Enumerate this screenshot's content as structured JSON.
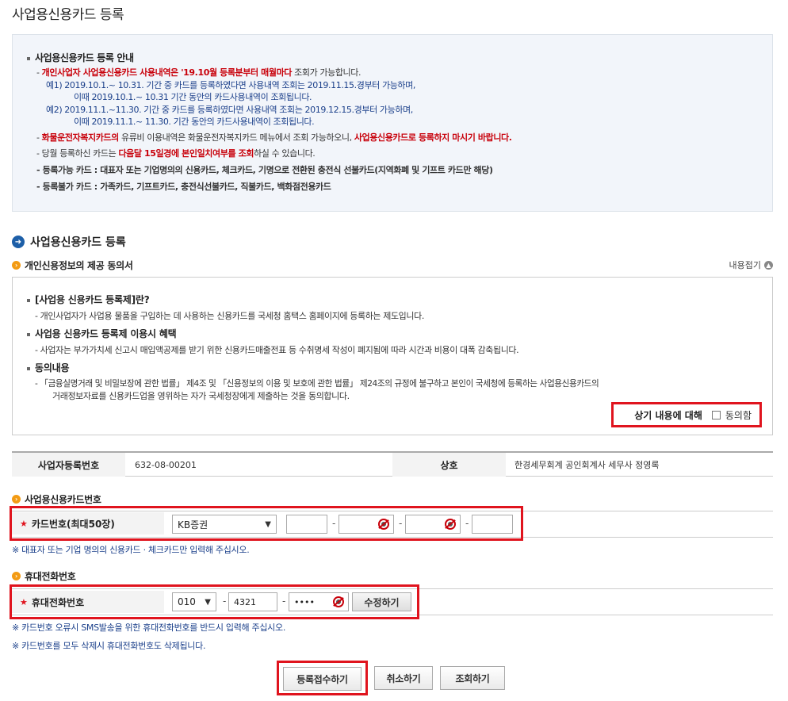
{
  "page_title": "사업용신용카드 등록",
  "guide": {
    "heading": "사업용신용카드 등록 안내",
    "l1_dash": "- ",
    "l1_red": "개인사업자 사업용신용카드 사용내역은 '19.10월 등록분부터 매월마다",
    "l1_rest": " 조회가 가능합니다.",
    "ex1_a": "예1) 2019.10.1.~ 10.31. 기간 중 카드를 등록하였다면 사용내역 조회는 2019.11.15.경부터 가능하며,",
    "ex1_b": "이때 2019.10.1.~ 10.31 기간 동안의 카드사용내역이 조회됩니다.",
    "ex2_a": "예2) 2019.11.1.~11.30. 기간 중 카드를 등록하였다면 사용내역 조회는 2019.12.15.경부터 가능하며,",
    "ex2_b": "이때 2019.11.1.~ 11.30. 기간 동안의 카드사용내역이 조회됩니다.",
    "l2_red1": "화물운전자복지카드의",
    "l2_mid": " 유류비 이용내역은 화물운전자복지카드 메뉴에서 조회 가능하오니, ",
    "l2_red2": "사업용신용카드로 등록하지 마시기 바랍니다.",
    "l3_a": "당월 등록하신 카드는 ",
    "l3_red": "다음달 15일경에 본인일치여부를 조회",
    "l3_b": "하실 수 있습니다.",
    "l4": "등록가능 카드 : 대표자 또는 기업명의의 신용카드, 체크카드, 기명으로 전환된 충전식 선불카드(지역화폐 및 기프트 카드만 해당)",
    "l5": "등록불가 카드 : 가족카드, 기프트카드, 충전식선불카드, 직불카드, 백화점전용카드"
  },
  "section_title": "사업용신용카드 등록",
  "consent": {
    "title": "개인신용정보의 제공 동의서",
    "collapse_label": "내용접기",
    "h1": "[사업용 신용카드 등록제]란?",
    "t1": "- 개인사업자가 사업용 물품을 구입하는 데 사용하는 신용카드를 국세청 홈택스 홈페이지에 등록하는 제도입니다.",
    "h2": "사업용 신용카드 등록제 이용시 혜택",
    "t2": "- 사업자는 부가가치세 신고시 매입액공제를 받기 위한 신용카드매출전표 등 수취명세 작성이 폐지됨에 따라 시간과 비용이 대폭 감축됩니다.",
    "h3": "동의내용",
    "t3a": "- 「금융실명거래 및 비밀보장에 관한 법률」 제4조 및 「신용정보의 이용 및 보호에 관한 법률」 제24조의 규정에 불구하고 본인이 국세청에 등록하는 사업용신용카드의",
    "t3b": "거래정보자료를 신용카드업을 영위하는 자가 국세청장에게 제출하는 것을 동의합니다.",
    "agree_label": "상기 내용에 대해",
    "agree_checkbox": "동의함"
  },
  "biz_info": {
    "reg_no_label": "사업자등록번호",
    "reg_no_value": "632-08-00201",
    "name_label": "상호",
    "name_value": "한경세무회계 공인회계사 세무사 정영록"
  },
  "card": {
    "title": "사업용신용카드번호",
    "label": "카드번호(최대50장)",
    "company": "KB증권",
    "dash": "-",
    "note": "※ 대표자 또는 기업 명의의 신용카드 · 체크카드만 입력해 주십시오."
  },
  "phone": {
    "title": "휴대전화번호",
    "label": "휴대전화번호",
    "prefix": "010",
    "middle": "4321",
    "last_masked": "••••",
    "dash": "-",
    "edit_button": "수정하기",
    "note1": "※ 카드번호 오류시 SMS발송을 위한 휴대전화번호를 반드시 입력해 주십시오.",
    "note2": "※ 카드번호를 모두 삭제시 휴대전화번호도 삭제됩니다."
  },
  "buttons": {
    "submit": "등록접수하기",
    "cancel": "취소하기",
    "inquiry": "조회하기"
  },
  "colors": {
    "highlight_red": "#c8000a",
    "frame_red": "#e0141e",
    "note_blue": "#1a3f8a",
    "icon_blue": "#1d5fa8",
    "icon_orange": "#f39b14"
  }
}
